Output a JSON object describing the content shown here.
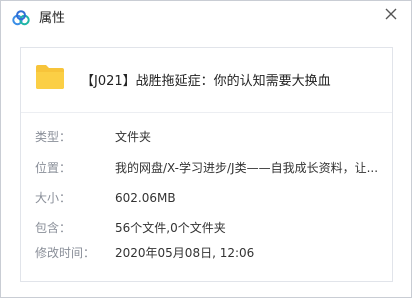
{
  "window": {
    "title": "属性"
  },
  "file": {
    "name": "【J021】战胜拖延症：你的认知需要大换血"
  },
  "properties": [
    {
      "label": "类型：",
      "value": "文件夹"
    },
    {
      "label": "位置：",
      "value": "我的网盘/X-学习进步/J类——自我成长资料，让..."
    },
    {
      "label": "大小：",
      "value": "602.06MB"
    },
    {
      "label": "包含：",
      "value": "56个文件,0个文件夹"
    },
    {
      "label": "修改时间：",
      "value": "2020年05月08日, 12:06"
    }
  ],
  "colors": {
    "folder": "#f7c43a",
    "brand_blue": "#3a8ee6",
    "label": "#8a8f99"
  },
  "icons": {
    "app": "baidu-netdisk-cloud-icon",
    "close": "close-icon",
    "folder": "folder-icon"
  }
}
